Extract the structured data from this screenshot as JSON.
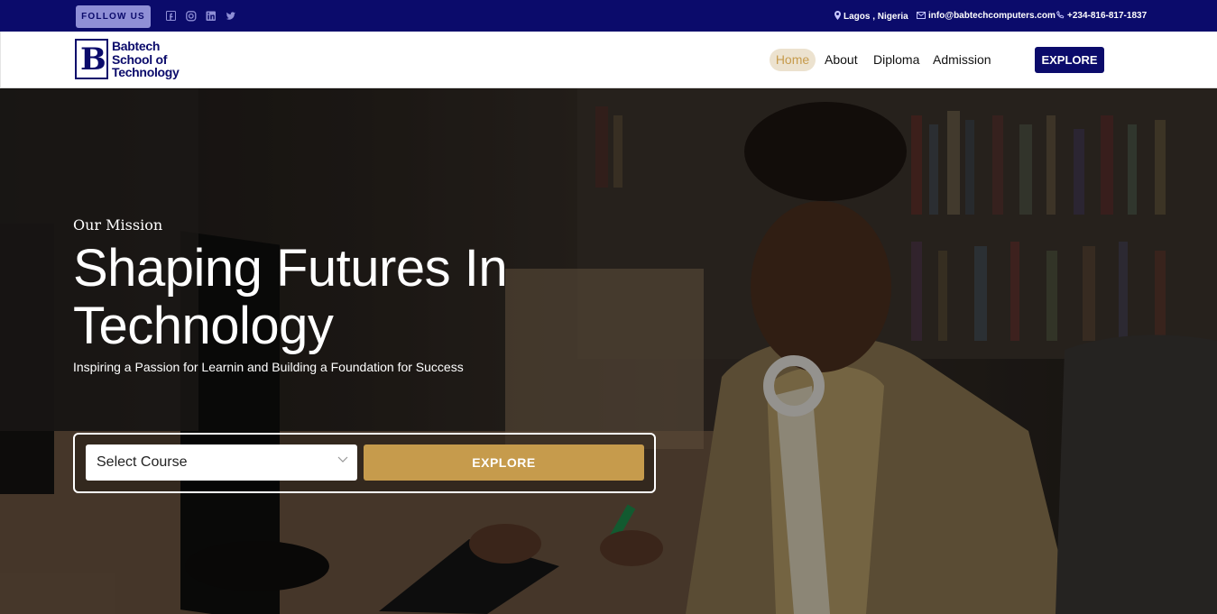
{
  "topbar": {
    "follow_label": "FOLLOW US",
    "social_icons": [
      "facebook-icon",
      "instagram-icon",
      "linkedin-icon",
      "twitter-icon"
    ],
    "location": "Lagos , Nigeria",
    "email": "info@babtechcomputers.com",
    "phone": "+234-816-817-1837"
  },
  "header": {
    "logo_text_line1": "Babtech",
    "logo_text_line2": "School of",
    "logo_text_line3": "Technology",
    "nav": [
      "Home",
      "About",
      "Diploma",
      "Admission"
    ],
    "active_nav": "Home",
    "explore_label": "EXPLORE"
  },
  "hero": {
    "mission": "Our Mission",
    "headline_line1": "Shaping Futures In",
    "headline_line2": "Technology",
    "subline": "Inspiring a Passion for Learnin and Building a Foundation for Success",
    "select_value": "Select Course",
    "explore_label": "EXPLORE"
  },
  "colors": {
    "navy": "#0b0b6b",
    "gold": "#c69b4c",
    "follow_bg": "#8f8fd6"
  }
}
